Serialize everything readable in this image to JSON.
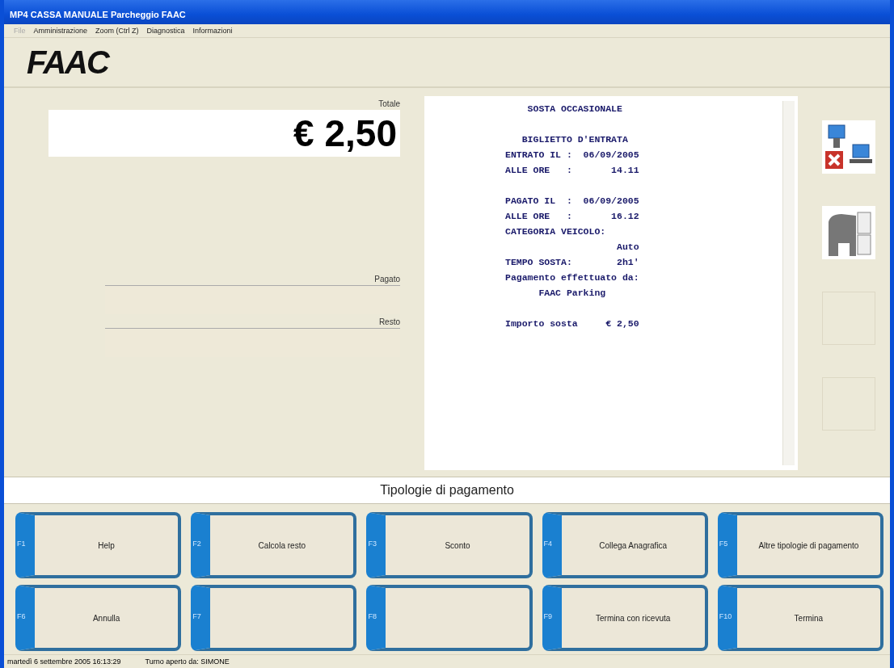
{
  "window": {
    "title": "MP4 CASSA MANUALE Parcheggio FAAC"
  },
  "menu": [
    {
      "label": "File",
      "disabled": true
    },
    {
      "label": "Amministrazione",
      "disabled": false
    },
    {
      "label": "Zoom (Ctrl Z)",
      "disabled": false
    },
    {
      "label": "Diagnostica",
      "disabled": false
    },
    {
      "label": "Informazioni",
      "disabled": false
    }
  ],
  "logo": "FAAC",
  "totale": {
    "label": "Totale",
    "value": "€ 2,50"
  },
  "pagato": {
    "label": "Pagato"
  },
  "resto": {
    "label": "Resto"
  },
  "receipt": [
    [
      "    SOSTA OCCASIONALE"
    ],
    [
      "   BIGLIETTO D'ENTRATA",
      "ENTRATO IL :  06/09/2005",
      "ALLE ORE   :       14.11"
    ],
    [
      "PAGATO IL  :  06/09/2005",
      "ALLE ORE   :       16.12",
      "CATEGORIA VEICOLO:",
      "                    Auto",
      "TEMPO SOSTA:        2h1'",
      "Pagamento effettuato da:",
      "      FAAC Parking"
    ],
    [
      "Importo sosta     € 2,50"
    ]
  ],
  "side_slots": [
    {
      "kind": "network-error"
    },
    {
      "kind": "printer"
    },
    {
      "kind": "empty"
    },
    {
      "kind": "empty"
    }
  ],
  "payment_header": "Tipologie di pagamento",
  "buttons": [
    {
      "key": "F1",
      "label": "Help"
    },
    {
      "key": "F2",
      "label": "Calcola resto"
    },
    {
      "key": "F3",
      "label": "Sconto"
    },
    {
      "key": "F4",
      "label": "Collega Anagrafica"
    },
    {
      "key": "F5",
      "label": "Altre tipologie di pagamento"
    },
    {
      "key": "F6",
      "label": "Annulla"
    },
    {
      "key": "F7"
    },
    {
      "key": "F8"
    },
    {
      "key": "F9",
      "label": "Termina con ricevuta"
    },
    {
      "key": "F10",
      "label": "Termina"
    }
  ],
  "status_bar": [
    "martedì 6 settembre 2005   16:13:29",
    "Turno aperto da: SIMONE"
  ]
}
